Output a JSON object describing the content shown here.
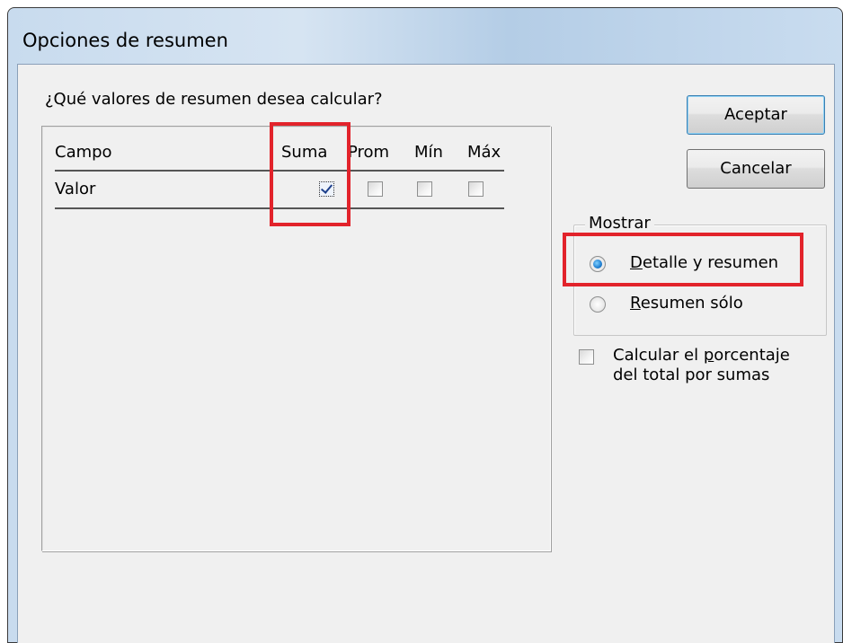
{
  "window": {
    "title": "Opciones de resumen"
  },
  "question": "¿Qué valores de resumen desea calcular?",
  "table": {
    "columns": [
      "Campo",
      "Suma",
      "Prom",
      "Mín",
      "Máx"
    ],
    "rows": [
      {
        "field": "Valor",
        "suma": true,
        "prom": false,
        "min": false,
        "max": false
      }
    ]
  },
  "buttons": {
    "accept": "Aceptar",
    "cancel": "Cancelar"
  },
  "show_group": {
    "title": "Mostrar",
    "options": [
      {
        "mnemonic": "D",
        "rest": "etalle y resumen",
        "selected": true
      },
      {
        "mnemonic": "R",
        "rest": "esumen sólo",
        "selected": false
      }
    ]
  },
  "percentage_option": {
    "line1_pre": "Calcular el ",
    "line1_mnemonic": "p",
    "line1_post": "orcentaje",
    "line2": "del total por sumas",
    "checked": false
  },
  "colors": {
    "highlight": "#e2232b",
    "dialog_background": "#f0f0f0",
    "titlebar": "#c8dbee"
  }
}
